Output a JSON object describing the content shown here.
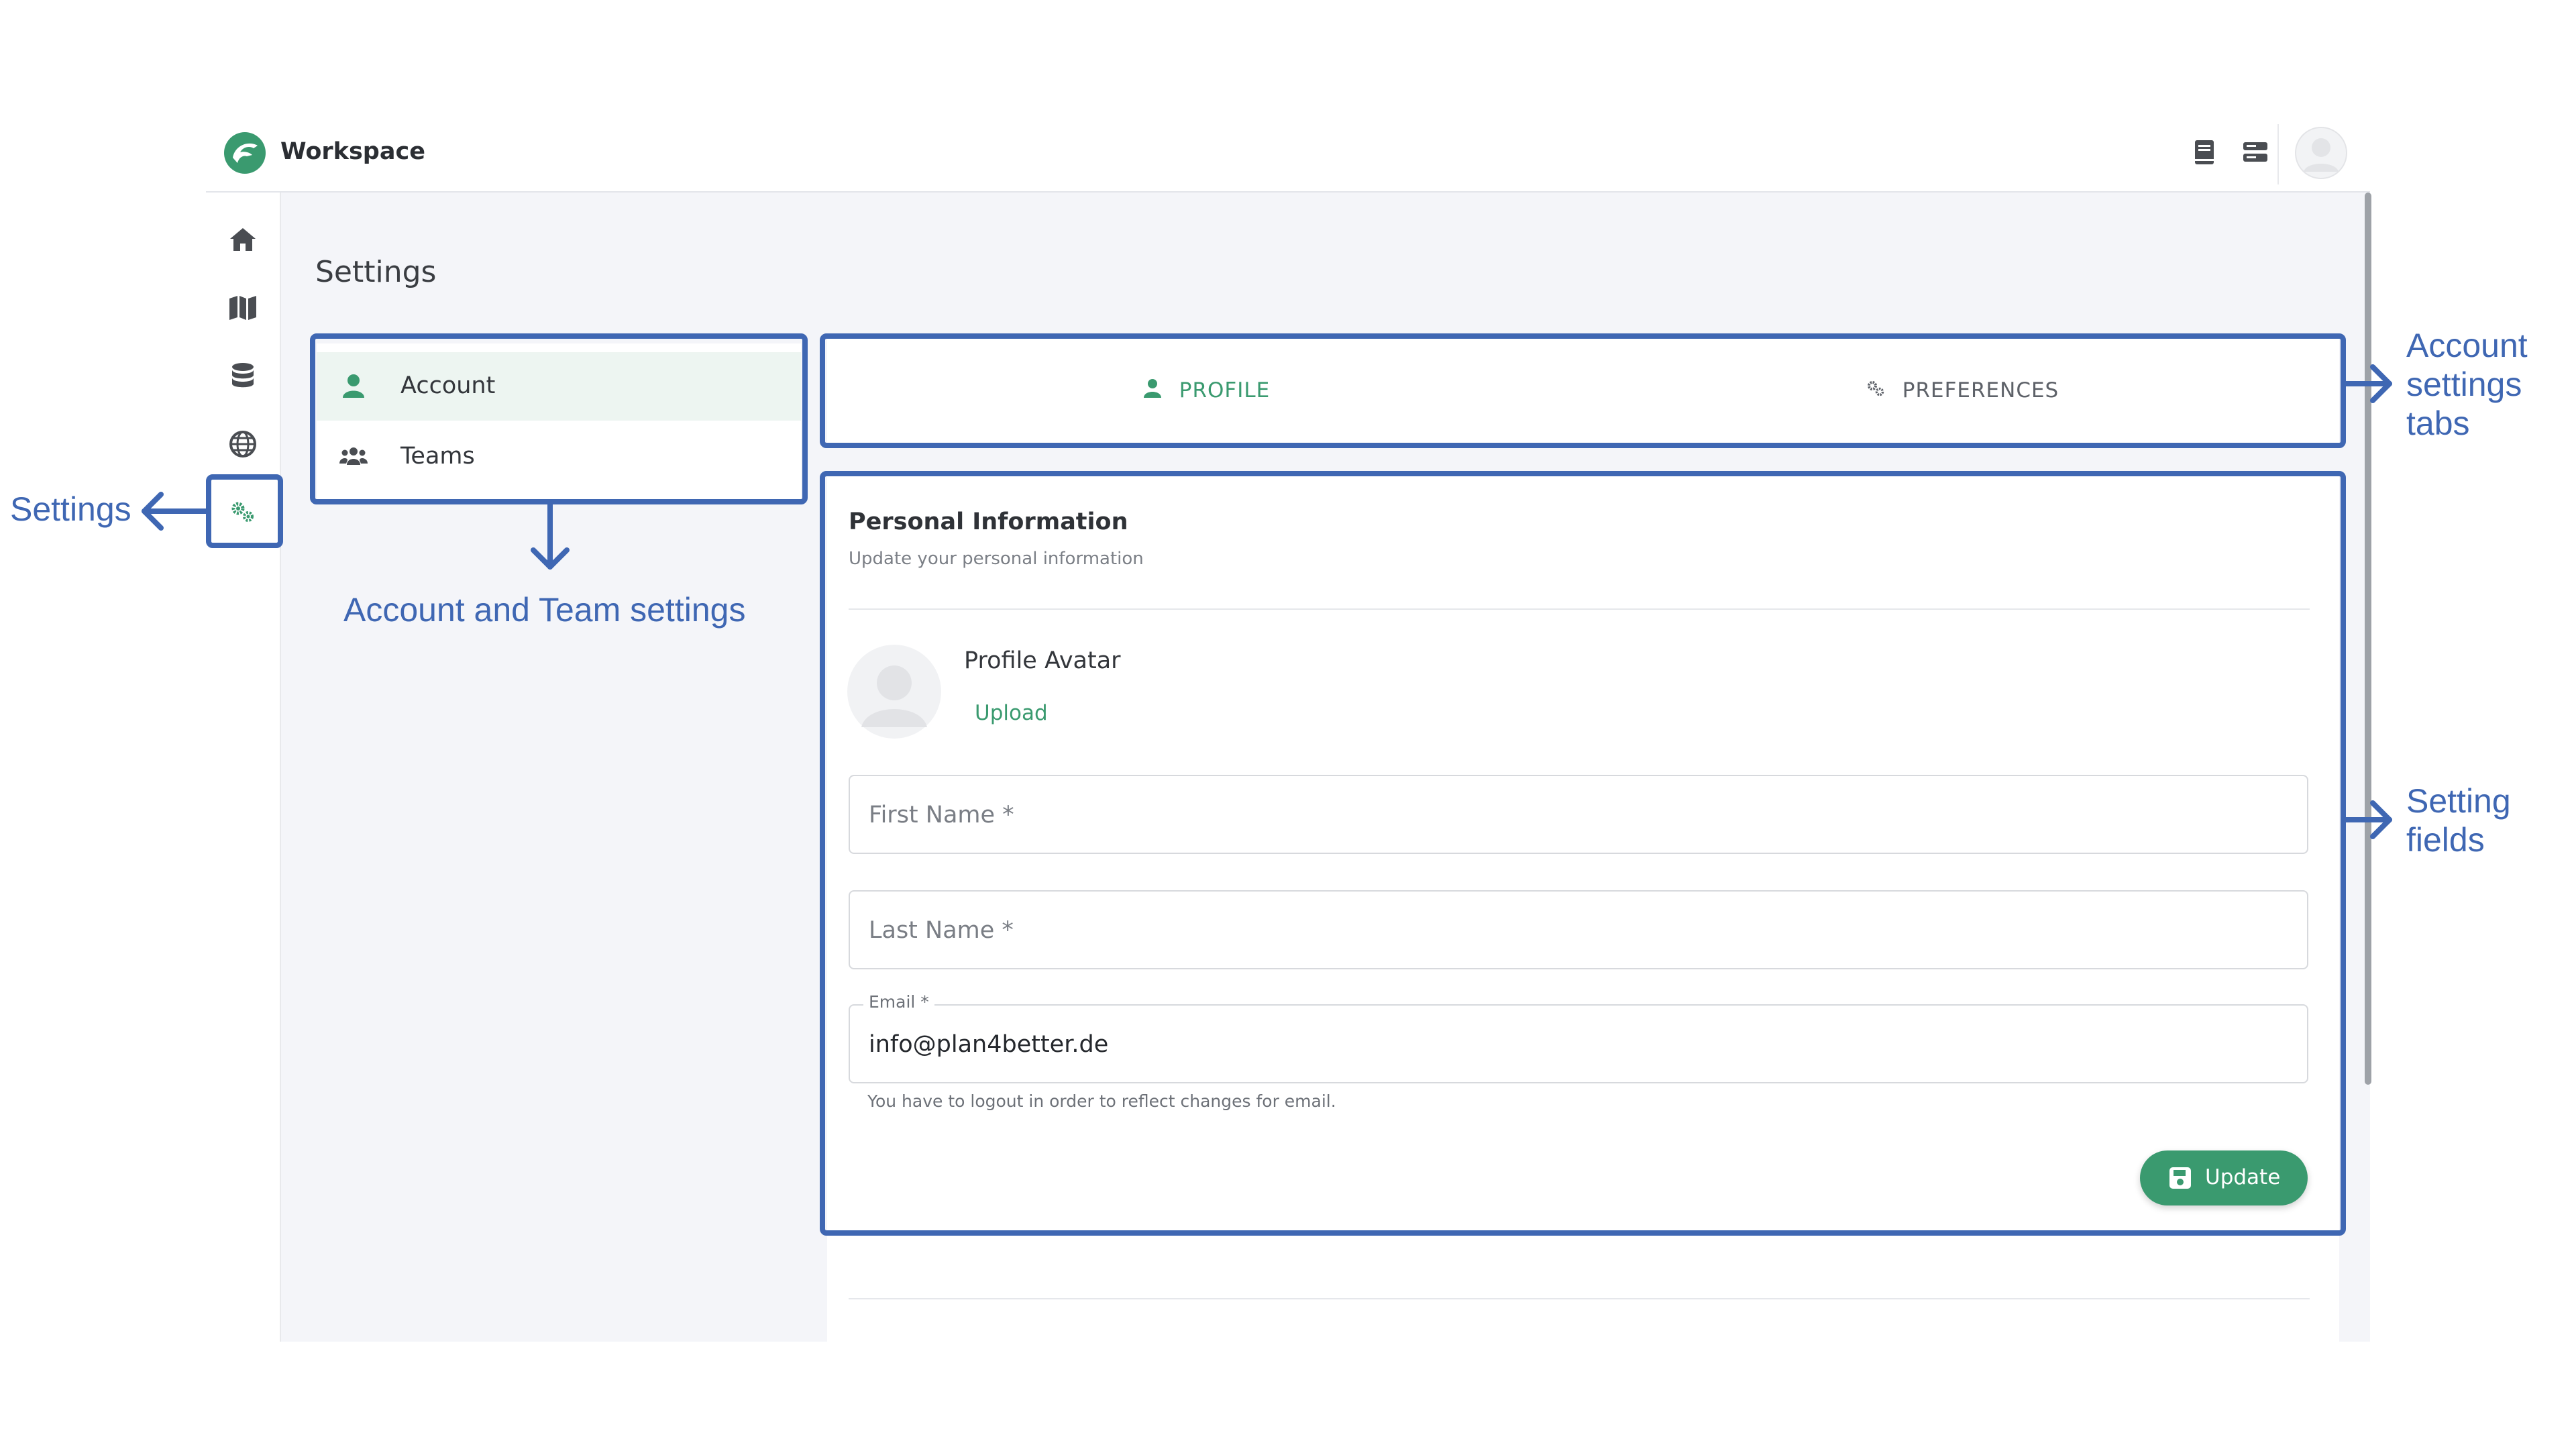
{
  "app": {
    "workspace_title": "Workspace",
    "accent_color": "#3a9a6f",
    "annotation_color": "#3f67b3"
  },
  "topbar": {
    "icons": [
      "book-icon",
      "server-icon"
    ],
    "avatar": "user-avatar"
  },
  "sidebar": {
    "items": [
      {
        "icon": "home-icon",
        "active": false
      },
      {
        "icon": "map-icon",
        "active": false
      },
      {
        "icon": "database-icon",
        "active": false
      },
      {
        "icon": "globe-icon",
        "active": false
      },
      {
        "icon": "gears-icon",
        "active": true
      }
    ]
  },
  "page": {
    "title": "Settings"
  },
  "settings_menu": {
    "items": [
      {
        "label": "Account",
        "icon": "user-icon",
        "active": true
      },
      {
        "label": "Teams",
        "icon": "users-icon",
        "active": false
      }
    ]
  },
  "tabs": [
    {
      "label": "PROFILE",
      "icon": "user-icon",
      "active": true
    },
    {
      "label": "PREFERENCES",
      "icon": "gears-icon",
      "active": false
    }
  ],
  "form": {
    "section_title": "Personal Information",
    "section_subtitle": "Update your personal information",
    "avatar_label": "Profile Avatar",
    "upload_label": "Upload",
    "first_name_placeholder": "First Name *",
    "last_name_placeholder": "Last Name *",
    "email_label": "Email *",
    "email_value": "info@plan4better.de",
    "email_hint": "You have to logout in order to reflect changes for email.",
    "update_label": "Update"
  },
  "annotations": {
    "settings": "Settings",
    "account_team": "Account and Team settings",
    "tabs": [
      "Account",
      "settings",
      "tabs"
    ],
    "fields": [
      "Setting",
      "fields"
    ]
  }
}
